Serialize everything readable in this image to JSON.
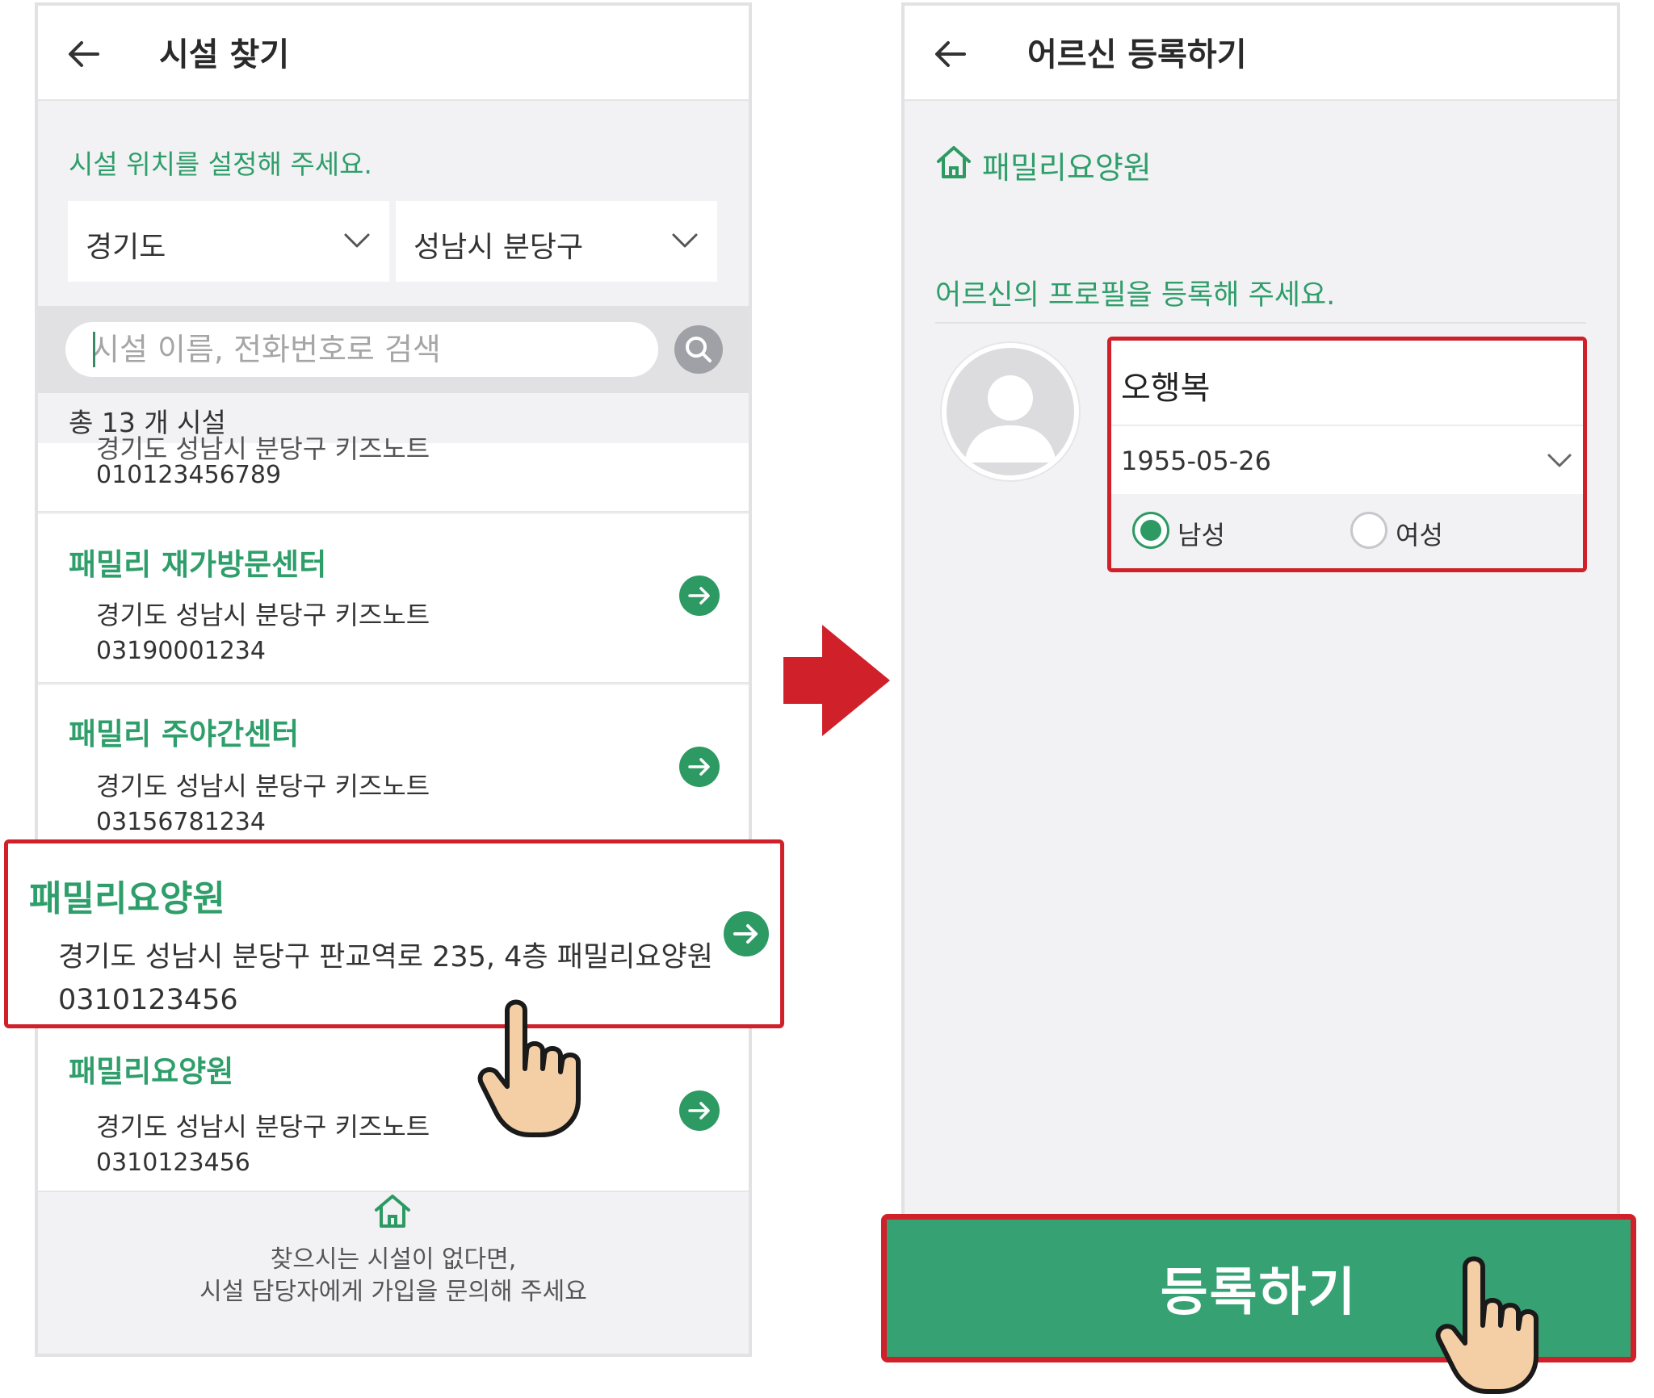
{
  "left_screen": {
    "title": "시설 찾기",
    "location_prompt": "시설 위치를 설정해 주세요.",
    "province": "경기도",
    "city": "성남시 분당구",
    "search_placeholder": "시설 이름, 전화번호로 검색",
    "total_count": "총 13 개 시설",
    "partial_item": {
      "addr": "경기도 성남시 분당구 키즈노트",
      "phone": "010123456789"
    },
    "items": [
      {
        "name": "패밀리 재가방문센터",
        "addr": "경기도 성남시 분당구 키즈노트",
        "phone": "03190001234"
      },
      {
        "name": "패밀리 주야간센터",
        "addr": "경기도 성남시 분당구 키즈노트",
        "phone": "03156781234"
      },
      {
        "name": "패밀리요양원",
        "addr": "경기도 성남시 분당구 키즈노트",
        "phone": "0310123456"
      }
    ],
    "highlighted_item": {
      "name": "패밀리요양원",
      "addr": "경기도 성남시 분당구 판교역로 235, 4층 패밀리요양원",
      "phone": "0310123456"
    },
    "footer": {
      "line1": "찾으시는 시설이 없다면,",
      "line2": "시설 담당자에게 가입을 문의해 주세요",
      "icon": "home-icon"
    }
  },
  "right_screen": {
    "title": "어르신 등록하기",
    "facility_name": "패밀리요양원",
    "profile_prompt": "어르신의 프로필을 등록해 주세요.",
    "name": "오행복",
    "birthdate": "1955-05-26",
    "gender_options": [
      {
        "label": "남성",
        "checked": true
      },
      {
        "label": "여성",
        "checked": false
      }
    ],
    "register_label": "등록하기"
  },
  "colors": {
    "accent_green": "#2e9e6a",
    "button_green": "#36a273",
    "highlight_red": "#d0212a"
  }
}
